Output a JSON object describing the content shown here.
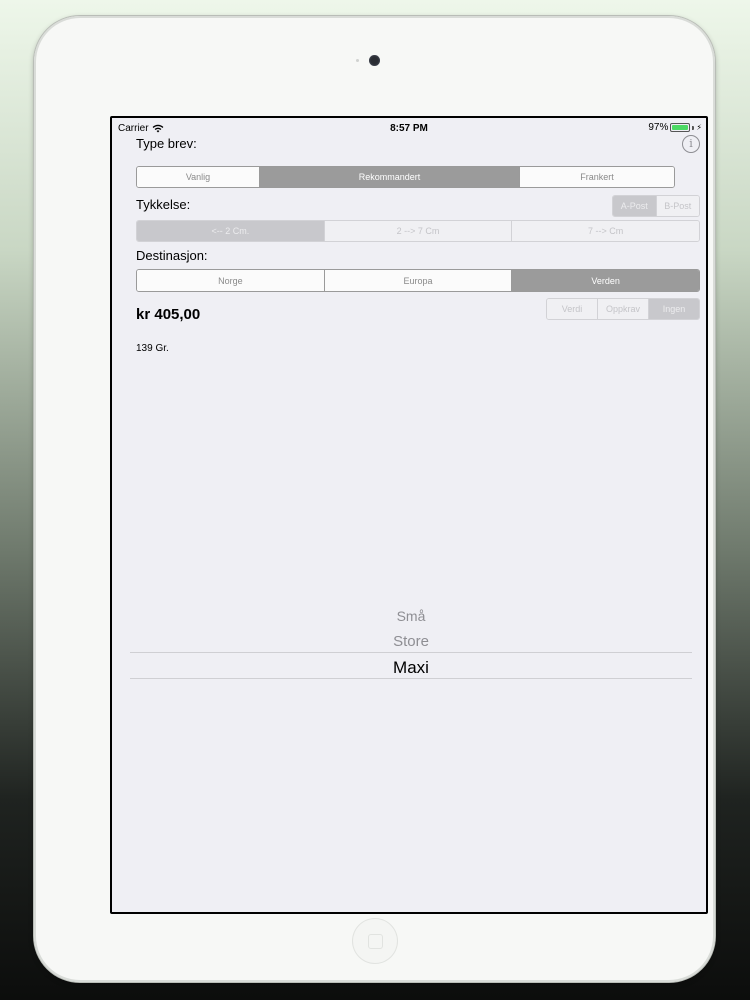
{
  "status_bar": {
    "carrier": "Carrier",
    "time": "8:57 PM",
    "battery": "97%"
  },
  "letter_type": {
    "label": "Type brev:",
    "options": [
      "Vanlig",
      "Rekommandert",
      "Frankert"
    ],
    "selected": "Rekommandert"
  },
  "thickness": {
    "label": "Tykkelse:",
    "post_class": {
      "options": [
        "A-Post",
        "B-Post"
      ],
      "selected": "A-Post"
    },
    "options": [
      "<-- 2 Cm.",
      "2 --> 7 Cm",
      "7 --> Cm"
    ],
    "selected": "<-- 2 Cm."
  },
  "destination": {
    "label": "Destinasjon:",
    "options": [
      "Norge",
      "Europa",
      "Verden"
    ],
    "selected": "Verden"
  },
  "extra_service": {
    "options": [
      "Verdi",
      "Oppkrav",
      "Ingen"
    ],
    "selected": "Ingen"
  },
  "price": "kr 405,00",
  "weight": "139 Gr.",
  "size_picker": {
    "items": [
      "Små",
      "Store",
      "Maxi"
    ],
    "selected": "Maxi"
  },
  "colors": {
    "selected_segment": "#9b9b9b",
    "screen_background": "#efeff4",
    "battery": "#4cd964"
  }
}
